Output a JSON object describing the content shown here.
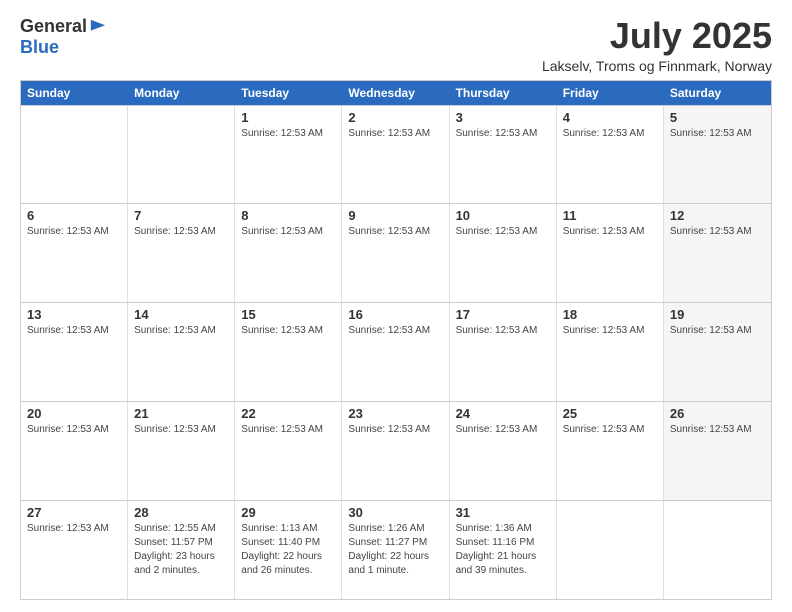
{
  "logo": {
    "general": "General",
    "blue": "Blue"
  },
  "title": "July 2025",
  "location": "Lakselv, Troms og Finnmark, Norway",
  "dayHeaders": [
    "Sunday",
    "Monday",
    "Tuesday",
    "Wednesday",
    "Thursday",
    "Friday",
    "Saturday"
  ],
  "weeks": [
    [
      {
        "day": "",
        "info": "",
        "empty": true
      },
      {
        "day": "",
        "info": "",
        "empty": true
      },
      {
        "day": "1",
        "info": "Sunrise: 12:53 AM",
        "saturday": false
      },
      {
        "day": "2",
        "info": "Sunrise: 12:53 AM",
        "saturday": false
      },
      {
        "day": "3",
        "info": "Sunrise: 12:53 AM",
        "saturday": false
      },
      {
        "day": "4",
        "info": "Sunrise: 12:53 AM",
        "saturday": false
      },
      {
        "day": "5",
        "info": "Sunrise: 12:53 AM",
        "saturday": true
      }
    ],
    [
      {
        "day": "6",
        "info": "Sunrise: 12:53 AM",
        "saturday": false
      },
      {
        "day": "7",
        "info": "Sunrise: 12:53 AM",
        "saturday": false
      },
      {
        "day": "8",
        "info": "Sunrise: 12:53 AM",
        "saturday": false
      },
      {
        "day": "9",
        "info": "Sunrise: 12:53 AM",
        "saturday": false
      },
      {
        "day": "10",
        "info": "Sunrise: 12:53 AM",
        "saturday": false
      },
      {
        "day": "11",
        "info": "Sunrise: 12:53 AM",
        "saturday": false
      },
      {
        "day": "12",
        "info": "Sunrise: 12:53 AM",
        "saturday": true
      }
    ],
    [
      {
        "day": "13",
        "info": "Sunrise: 12:53 AM",
        "saturday": false
      },
      {
        "day": "14",
        "info": "Sunrise: 12:53 AM",
        "saturday": false
      },
      {
        "day": "15",
        "info": "Sunrise: 12:53 AM",
        "saturday": false
      },
      {
        "day": "16",
        "info": "Sunrise: 12:53 AM",
        "saturday": false
      },
      {
        "day": "17",
        "info": "Sunrise: 12:53 AM",
        "saturday": false
      },
      {
        "day": "18",
        "info": "Sunrise: 12:53 AM",
        "saturday": false
      },
      {
        "day": "19",
        "info": "Sunrise: 12:53 AM",
        "saturday": true
      }
    ],
    [
      {
        "day": "20",
        "info": "Sunrise: 12:53 AM",
        "saturday": false
      },
      {
        "day": "21",
        "info": "Sunrise: 12:53 AM",
        "saturday": false
      },
      {
        "day": "22",
        "info": "Sunrise: 12:53 AM",
        "saturday": false
      },
      {
        "day": "23",
        "info": "Sunrise: 12:53 AM",
        "saturday": false
      },
      {
        "day": "24",
        "info": "Sunrise: 12:53 AM",
        "saturday": false
      },
      {
        "day": "25",
        "info": "Sunrise: 12:53 AM",
        "saturday": false
      },
      {
        "day": "26",
        "info": "Sunrise: 12:53 AM",
        "saturday": true
      }
    ],
    [
      {
        "day": "27",
        "info": "Sunrise: 12:53 AM",
        "saturday": false
      },
      {
        "day": "28",
        "info": "Sunrise: 12:55 AM\nSunset: 11:57 PM\nDaylight: 23 hours and 2 minutes.",
        "saturday": false
      },
      {
        "day": "29",
        "info": "Sunrise: 1:13 AM\nSunset: 11:40 PM\nDaylight: 22 hours and 26 minutes.",
        "saturday": false
      },
      {
        "day": "30",
        "info": "Sunrise: 1:26 AM\nSunset: 11:27 PM\nDaylight: 22 hours and 1 minute.",
        "saturday": false
      },
      {
        "day": "31",
        "info": "Sunrise: 1:36 AM\nSunset: 11:16 PM\nDaylight: 21 hours and 39 minutes.",
        "saturday": false
      },
      {
        "day": "",
        "info": "",
        "empty": true
      },
      {
        "day": "",
        "info": "",
        "empty": true,
        "saturday": true
      }
    ]
  ]
}
